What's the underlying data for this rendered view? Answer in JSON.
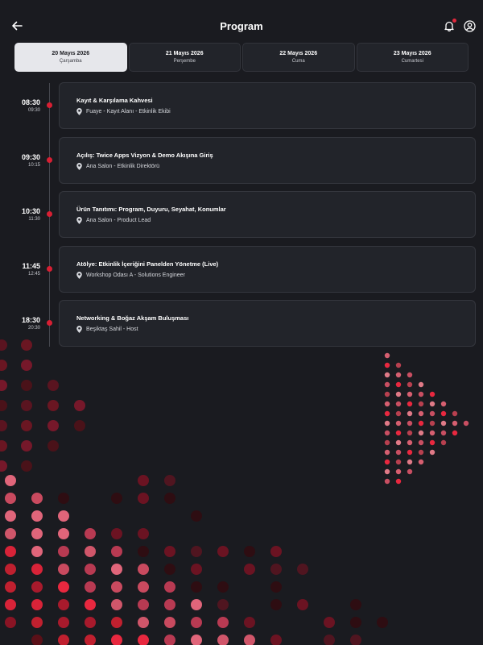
{
  "header": {
    "title": "Program",
    "back_icon": "arrow-left-icon",
    "notification_icon": "bell-icon",
    "profile_icon": "user-circle-icon"
  },
  "tabs": [
    {
      "date": "20 Mayıs 2026",
      "day": "Çarşamba",
      "active": true
    },
    {
      "date": "21 Mayıs 2026",
      "day": "Perşembe",
      "active": false
    },
    {
      "date": "22 Mayıs 2026",
      "day": "Cuma",
      "active": false
    },
    {
      "date": "23 Mayıs 2026",
      "day": "Cumartesi",
      "active": false
    }
  ],
  "events": [
    {
      "start": "08:30",
      "end": "09:30",
      "title": "Kayıt & Karşılama Kahvesi",
      "location": "Fuaye - Kayıt Alanı - Etkinlik Ekibi"
    },
    {
      "start": "09:30",
      "end": "10:15",
      "title": "Açılış: Twice Apps Vizyon & Demo Akışına Giriş",
      "location": "Ana Salon - Etkinlik Direktörü"
    },
    {
      "start": "10:30",
      "end": "11:30",
      "title": "Ürün Tanıtımı: Program, Duyuru, Seyahat, Konumlar",
      "location": "Ana Salon - Product Lead"
    },
    {
      "start": "11:45",
      "end": "12:45",
      "title": "Atölye: Etkinlik İçeriğini Panelden Yönetme (Live)",
      "location": "Workshop Odası A - Solutions Engineer"
    },
    {
      "start": "18:30",
      "end": "20:30",
      "title": "Networking & Boğaz Akşam Buluşması",
      "location": "Beşiktaş Sahil - Host"
    }
  ],
  "colors": {
    "background": "#1a1b20",
    "card": "#22242a",
    "accent": "#d81f33",
    "active_tab": "#e6e7eb",
    "location_icon": "map-pin-icon"
  }
}
